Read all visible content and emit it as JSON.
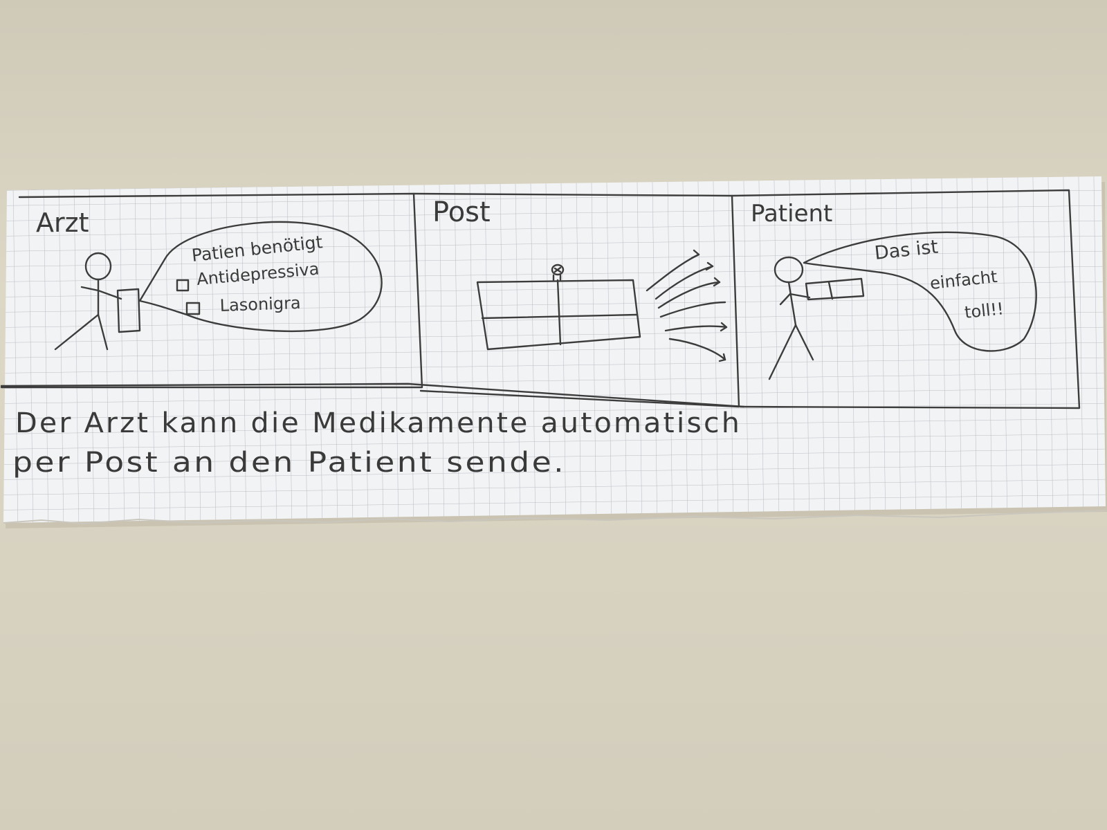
{
  "panels": [
    {
      "title": "Arzt",
      "speech": {
        "heading": "Patien benötigt",
        "options": [
          "Antidepressiva",
          "Lasonigra"
        ]
      }
    },
    {
      "title": "Post"
    },
    {
      "title": "Patient",
      "speech": {
        "lines": [
          "Das ist",
          "einfacht",
          "toll!!"
        ]
      }
    }
  ],
  "caption": {
    "line1": "Der Arzt kann die Medikamente automatisch",
    "line2": "per Post an den Patient sende."
  },
  "colors": {
    "table": "#d6d0c0",
    "paper": "#f2f3f4",
    "grid": "#b9bcc4",
    "ink": "#3c3c3c"
  }
}
